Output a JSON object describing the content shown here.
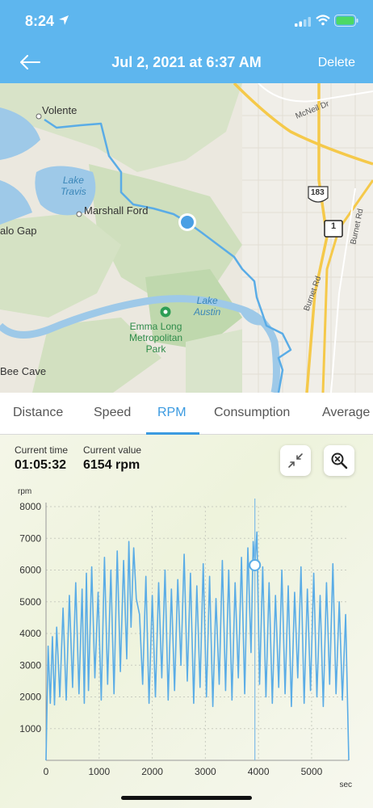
{
  "status_bar": {
    "time": "8:24"
  },
  "nav": {
    "title": "Jul 2, 2021 at 6:37 AM",
    "delete_label": "Delete"
  },
  "map": {
    "labels": {
      "volente": "Volente",
      "lake_travis": "Lake\nTravis",
      "marshall_ford": "Marshall Ford",
      "alo_gap": "alo Gap",
      "lake_austin": "Lake\nAustin",
      "emma_long": "Emma Long\nMetropolitan\nPark",
      "bee_cave": "Bee Cave",
      "mcneil_dr": "McNeil Dr",
      "burnet_rd_1": "Burnet Rd",
      "burnet_rd_2": "Burnet Rd",
      "shield_183": "183",
      "shield_1": "1"
    }
  },
  "tabs": [
    {
      "label": "Distance",
      "active": false
    },
    {
      "label": "Speed",
      "active": false
    },
    {
      "label": "RPM",
      "active": true
    },
    {
      "label": "Consumption",
      "active": false
    },
    {
      "label": "Average",
      "active": false
    }
  ],
  "readout": {
    "current_time_label": "Current time",
    "current_time_value": "01:05:32",
    "current_value_label": "Current value",
    "current_value_value": "6154 rpm"
  },
  "controls": {
    "collapse_icon": "collapse-arrows-icon",
    "zoom_icon": "zoom-out-icon"
  },
  "chart_data": {
    "type": "line",
    "ylabel": "rpm",
    "xlabel": "sec",
    "xlim": [
      0,
      5700
    ],
    "ylim": [
      0,
      8000
    ],
    "x_ticks": [
      0,
      1000,
      2000,
      3000,
      4000,
      5000
    ],
    "y_ticks": [
      1000,
      2000,
      3000,
      4000,
      5000,
      6000,
      7000,
      8000
    ],
    "grid": true,
    "line_color": "#5aace6",
    "cursor": {
      "x": 3932,
      "y": 6154
    },
    "series": [
      {
        "x": [
          0,
          40,
          80,
          120,
          160,
          200,
          260,
          320,
          380,
          440,
          500,
          560,
          620,
          680,
          720,
          760,
          800,
          860,
          920,
          980,
          1040,
          1100,
          1160,
          1220,
          1280,
          1340,
          1400,
          1460,
          1520,
          1560,
          1600,
          1650,
          1700,
          1760,
          1820,
          1880,
          1940,
          2000,
          2060,
          2120,
          2180,
          2240,
          2300,
          2360,
          2420,
          2480,
          2540,
          2600,
          2660,
          2720,
          2780,
          2840,
          2900,
          2960,
          3020,
          3080,
          3140,
          3200,
          3260,
          3320,
          3380,
          3440,
          3500,
          3560,
          3620,
          3680,
          3740,
          3800,
          3860,
          3900,
          3932,
          3970,
          4020,
          4080,
          4140,
          4200,
          4260,
          4320,
          4380,
          4440,
          4500,
          4560,
          4620,
          4680,
          4740,
          4800,
          4860,
          4920,
          4980,
          5040,
          5100,
          5160,
          5220,
          5280,
          5340,
          5400,
          5460,
          5520,
          5580,
          5640,
          5700
        ],
        "values": [
          0,
          3600,
          1800,
          3900,
          1750,
          4200,
          2000,
          4800,
          1900,
          5200,
          2300,
          5600,
          2100,
          5400,
          1800,
          5900,
          2200,
          6100,
          2600,
          5300,
          1900,
          6400,
          2400,
          6000,
          2100,
          6600,
          2800,
          6300,
          3200,
          6900,
          4200,
          6700,
          5100,
          4600,
          2400,
          5800,
          1800,
          5200,
          2000,
          5600,
          2600,
          6000,
          1900,
          5400,
          2200,
          5700,
          3000,
          6500,
          2500,
          5900,
          1800,
          5500,
          2300,
          6200,
          2000,
          5800,
          1700,
          5100,
          2400,
          6300,
          2200,
          6000,
          1900,
          5600,
          2600,
          6400,
          2100,
          6700,
          3400,
          6900,
          6154,
          7200,
          2400,
          6100,
          2000,
          5600,
          1800,
          5200,
          2300,
          6000,
          2100,
          5500,
          1700,
          5300,
          2600,
          6100,
          1800,
          5400,
          2200,
          5900,
          2000,
          5200,
          1700,
          5600,
          2400,
          6200,
          2100,
          5000,
          1900,
          4600,
          0
        ]
      }
    ]
  }
}
